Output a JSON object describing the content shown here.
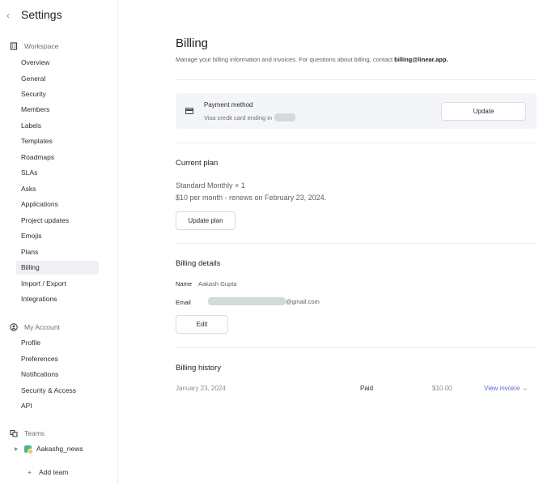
{
  "sidebar": {
    "back_glyph": "‹",
    "title": "Settings",
    "workspace_label": "Workspace",
    "workspace_items": [
      "Overview",
      "General",
      "Security",
      "Members",
      "Labels",
      "Templates",
      "Roadmaps",
      "SLAs",
      "Asks",
      "Applications",
      "Project updates",
      "Emojis",
      "Plans",
      "Billing",
      "Import / Export",
      "Integrations"
    ],
    "active_item": "Billing",
    "account_label": "My Account",
    "account_items": [
      "Profile",
      "Preferences",
      "Notifications",
      "Security & Access",
      "API"
    ],
    "teams_label": "Teams",
    "team_name": "Aakashg_news",
    "add_team": "Add team"
  },
  "billing": {
    "title": "Billing",
    "description": "Manage your billing information and invoices. For questions about billing, contact",
    "contact_email": "billing@linear.app.",
    "payment": {
      "title": "Payment method",
      "subtitle": "Visa credit card ending in",
      "button": "Update"
    },
    "plan": {
      "heading": "Current plan",
      "name": "Standard Monthly × 1",
      "price": "$10 per month - renews on February 23, 2024.",
      "button": "Update plan"
    },
    "details": {
      "heading": "Billing details",
      "name_label": "Name",
      "name_value": "Aakash Gupta",
      "email_label": "Email",
      "email_suffix": "@gmail.com",
      "button": "Edit"
    },
    "history": {
      "heading": "Billing history",
      "rows": [
        {
          "date": "January 23, 2024",
          "status": "Paid",
          "amount": "$10.00",
          "action": "View invoice →"
        }
      ]
    }
  },
  "colors": {
    "accent": "#5e6ad2",
    "active_bg": "#eef0f4",
    "card_bg": "#f4f5f8",
    "redaction": "#d2dadb"
  }
}
